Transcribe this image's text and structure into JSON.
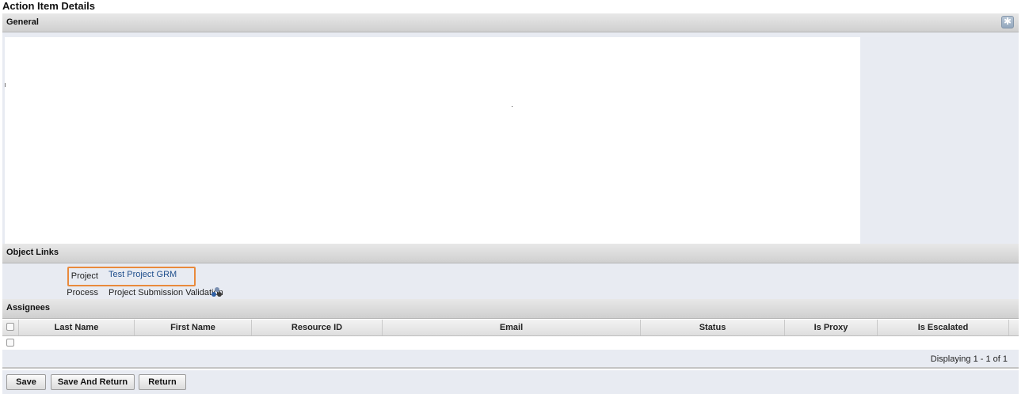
{
  "page": {
    "title": "Action Item Details"
  },
  "general": {
    "title": "General",
    "collapse_glyph": "✱"
  },
  "object_links": {
    "title": "Object Links",
    "rows": [
      {
        "label": "Project",
        "value": "Test Project GRM"
      },
      {
        "label": "Process",
        "value": "Project Submission Validation"
      }
    ]
  },
  "assignees": {
    "title": "Assignees",
    "columns": [
      "Last Name",
      "First Name",
      "Resource ID",
      "Email",
      "Status",
      "Is Proxy",
      "Is Escalated"
    ],
    "footer": "Displaying 1 - 1 of 1"
  },
  "buttons": {
    "save": "Save",
    "save_and_return": "Save And Return",
    "return": "Return"
  },
  "colors": {
    "highlight": "#e98a3c",
    "link": "#1f4e8c",
    "panel": "#e8ebf2"
  },
  "icons": {
    "collapse": "collapse-icon",
    "process": "process-link-icon"
  }
}
